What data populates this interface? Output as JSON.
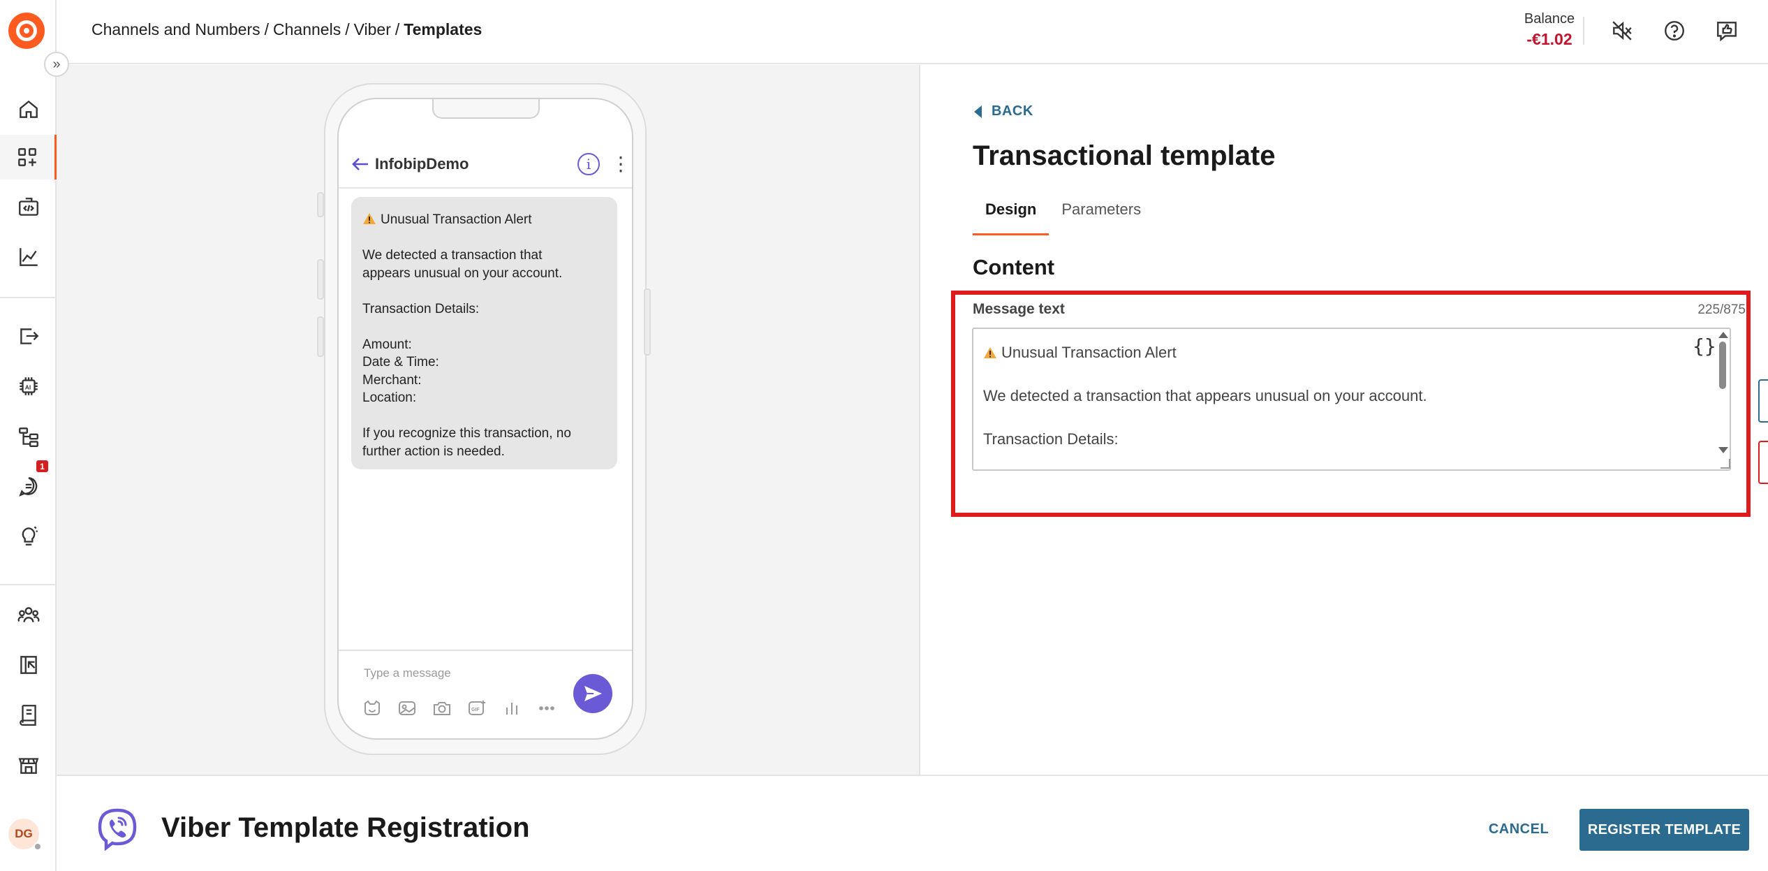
{
  "header": {
    "breadcrumb": [
      "Channels and Numbers",
      "Channels",
      "Viber",
      "Templates"
    ],
    "balance_label": "Balance",
    "balance_value": "-€1.02",
    "icons": [
      "mute-icon",
      "help-icon",
      "feedback-icon"
    ]
  },
  "sidebar": {
    "items": [
      {
        "name": "home",
        "icon": "home-icon"
      },
      {
        "name": "apps",
        "icon": "apps-icon",
        "active": true
      },
      {
        "name": "developer",
        "icon": "code-icon"
      },
      {
        "name": "analytics",
        "icon": "chart-icon"
      },
      {
        "name": "exports",
        "icon": "export-icon"
      },
      {
        "name": "ai",
        "icon": "ai-chip-icon"
      },
      {
        "name": "flows",
        "icon": "flow-icon"
      },
      {
        "name": "conversations",
        "icon": "chat-icon",
        "badge": "1"
      },
      {
        "name": "ideas",
        "icon": "bulb-icon"
      },
      {
        "name": "people",
        "icon": "people-icon"
      },
      {
        "name": "exchange",
        "icon": "exchange-icon"
      },
      {
        "name": "docs",
        "icon": "docs-icon"
      },
      {
        "name": "marketplace",
        "icon": "store-icon"
      }
    ],
    "avatar_initials": "DG"
  },
  "preview": {
    "chat_name": "InfobipDemo",
    "message_title": "Unusual Transaction Alert",
    "message_lines": [
      "We detected a transaction that",
      "appears unusual on your account.",
      "",
      "Transaction Details:",
      "",
      "Amount:",
      "Date & Time:",
      "Merchant:",
      "Location:",
      "",
      "If you recognize this transaction, no",
      "further action is needed."
    ],
    "input_placeholder": "Type a message"
  },
  "panel": {
    "back_label": "BACK",
    "title": "Transactional template",
    "tabs": [
      {
        "label": "Design",
        "active": true
      },
      {
        "label": "Parameters",
        "active": false
      }
    ],
    "section_title": "Content",
    "field_label": "Message text",
    "char_count": "225/875",
    "text_title": "Unusual Transaction Alert",
    "text_lines": [
      "",
      "We detected a transaction that appears unusual on your account.",
      "",
      "Transaction Details:"
    ],
    "placeholder_icon": "{}"
  },
  "footer": {
    "title": "Viber Template Registration",
    "cancel_label": "CANCEL",
    "register_label": "REGISTER TEMPLATE"
  },
  "colors": {
    "brand": "#ff5a1f",
    "primary_button": "#2a6b8f",
    "viber": "#6a5ad6",
    "balance_negative": "#c2142e",
    "highlight": "#e01b1b"
  }
}
